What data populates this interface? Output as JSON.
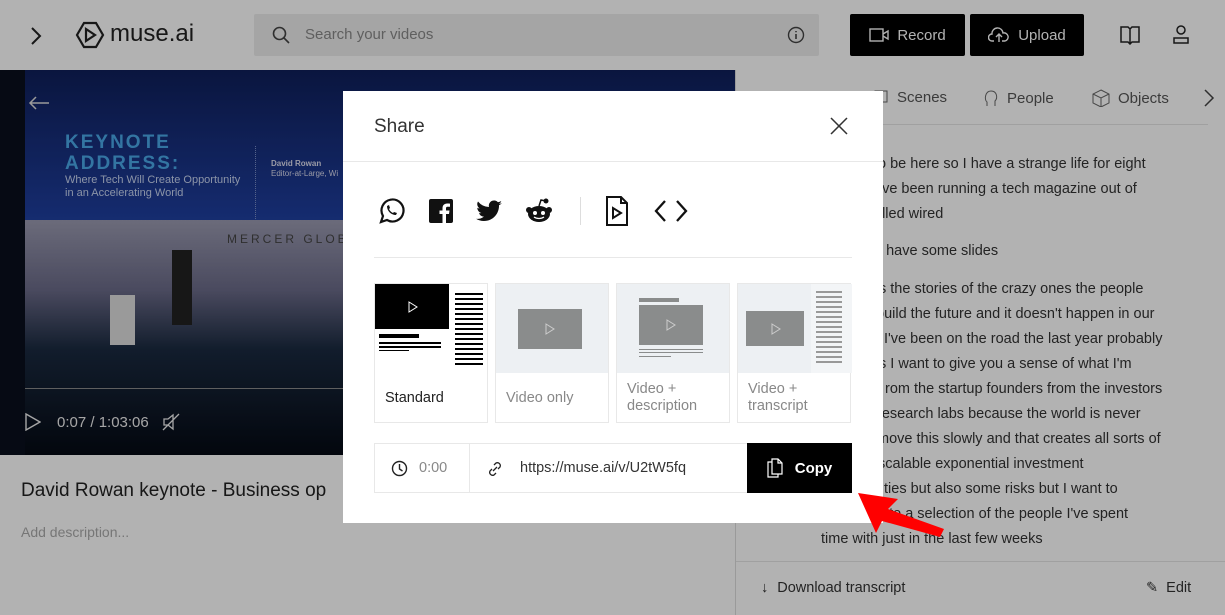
{
  "header": {
    "brand": "muse.ai",
    "search_placeholder": "Search your videos",
    "record_label": "Record",
    "upload_label": "Upload"
  },
  "video": {
    "slide_title_1": "KEYNOTE",
    "slide_title_2": "ADDRESS:",
    "slide_subtitle_1": "Where Tech Will Create Opportunity",
    "slide_subtitle_2": "in an Accelerating World",
    "speaker": "David Rowan",
    "speaker_role": "Editor-at-Large, Wi",
    "stage_text": "MERCER GLOBA",
    "time": "0:07 / 1:03:06",
    "title": "David Rowan keynote - Business op",
    "description_placeholder": "Add description..."
  },
  "tabs": [
    {
      "label": "Scenes"
    },
    {
      "label": "People"
    },
    {
      "label": "Objects"
    }
  ],
  "transcript": [
    "to be here so I have a strange life for eight",
    "ave been running a tech magazine out of",
    "alled wired",
    "e have some slides",
    "s the stories of the crazy ones the people",
    "build the future and it doesn't happen in our",
    "I've been on the road the last year probably",
    "s I want to give you a sense of what I'm",
    "rom the startup founders from the investors",
    "research labs because the world is never",
    "move this slowly and that creates all sorts of",
    "scalable exponential investment",
    "ties but also some risks but I want to",
    "u to a selection of the people I've spent",
    "time with just in the last few weeks"
  ],
  "footer": {
    "download": "Download transcript",
    "edit": "Edit"
  },
  "modal": {
    "title": "Share",
    "layouts": [
      {
        "label": "Standard"
      },
      {
        "label": "Video only"
      },
      {
        "label": "Video + description"
      },
      {
        "label": "Video + transcript"
      }
    ],
    "start_time": "0:00",
    "url": "https://muse.ai/v/U2tW5fq",
    "copy_label": "Copy"
  },
  "colors": {
    "accent": "#000000",
    "arrow": "#ff0000"
  }
}
